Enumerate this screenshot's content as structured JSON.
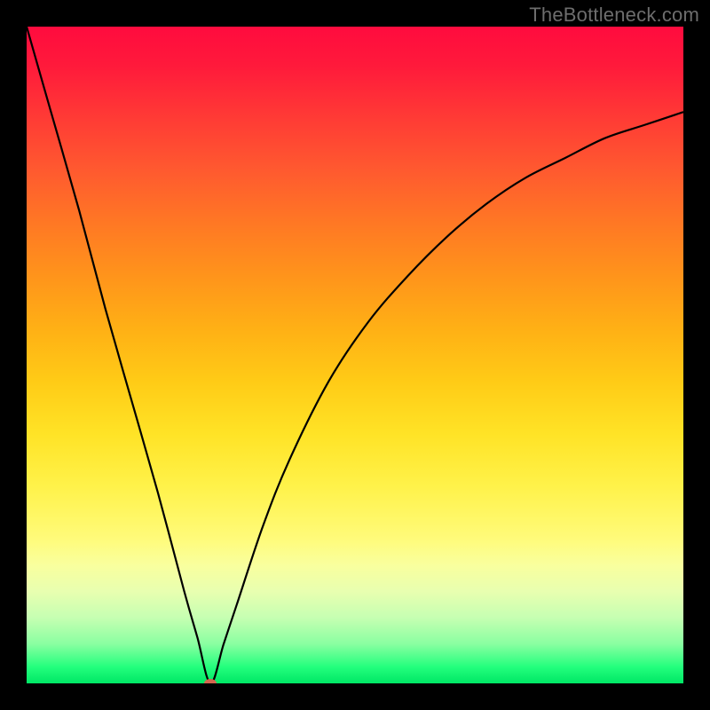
{
  "watermark": {
    "text": "TheBottleneck.com"
  },
  "colors": {
    "frame": "#000000",
    "curve": "#000000",
    "marker": "#d4664f"
  },
  "chart_data": {
    "type": "line",
    "title": "",
    "xlabel": "",
    "ylabel": "",
    "xlim": [
      0,
      100
    ],
    "ylim": [
      0,
      100
    ],
    "grid": false,
    "legend": false,
    "x_optimum": 28,
    "series": [
      {
        "name": "bottleneck-curve",
        "x": [
          0,
          4,
          8,
          12,
          16,
          20,
          24,
          26,
          28,
          30,
          32,
          36,
          40,
          46,
          52,
          58,
          64,
          70,
          76,
          82,
          88,
          94,
          100
        ],
        "values": [
          100,
          86,
          72,
          57,
          43,
          29,
          14,
          7,
          0,
          6,
          12,
          24,
          34,
          46,
          55,
          62,
          68,
          73,
          77,
          80,
          83,
          85,
          87
        ]
      }
    ],
    "marker": {
      "x": 28,
      "y": 0
    },
    "background_gradient": {
      "orientation": "vertical",
      "stops": [
        {
          "pos": 0.0,
          "color": "#ff0b3e"
        },
        {
          "pos": 0.3,
          "color": "#ff7824"
        },
        {
          "pos": 0.6,
          "color": "#ffe326"
        },
        {
          "pos": 0.82,
          "color": "#f9ff9e"
        },
        {
          "pos": 0.95,
          "color": "#8affa1"
        },
        {
          "pos": 1.0,
          "color": "#00e765"
        }
      ]
    }
  }
}
